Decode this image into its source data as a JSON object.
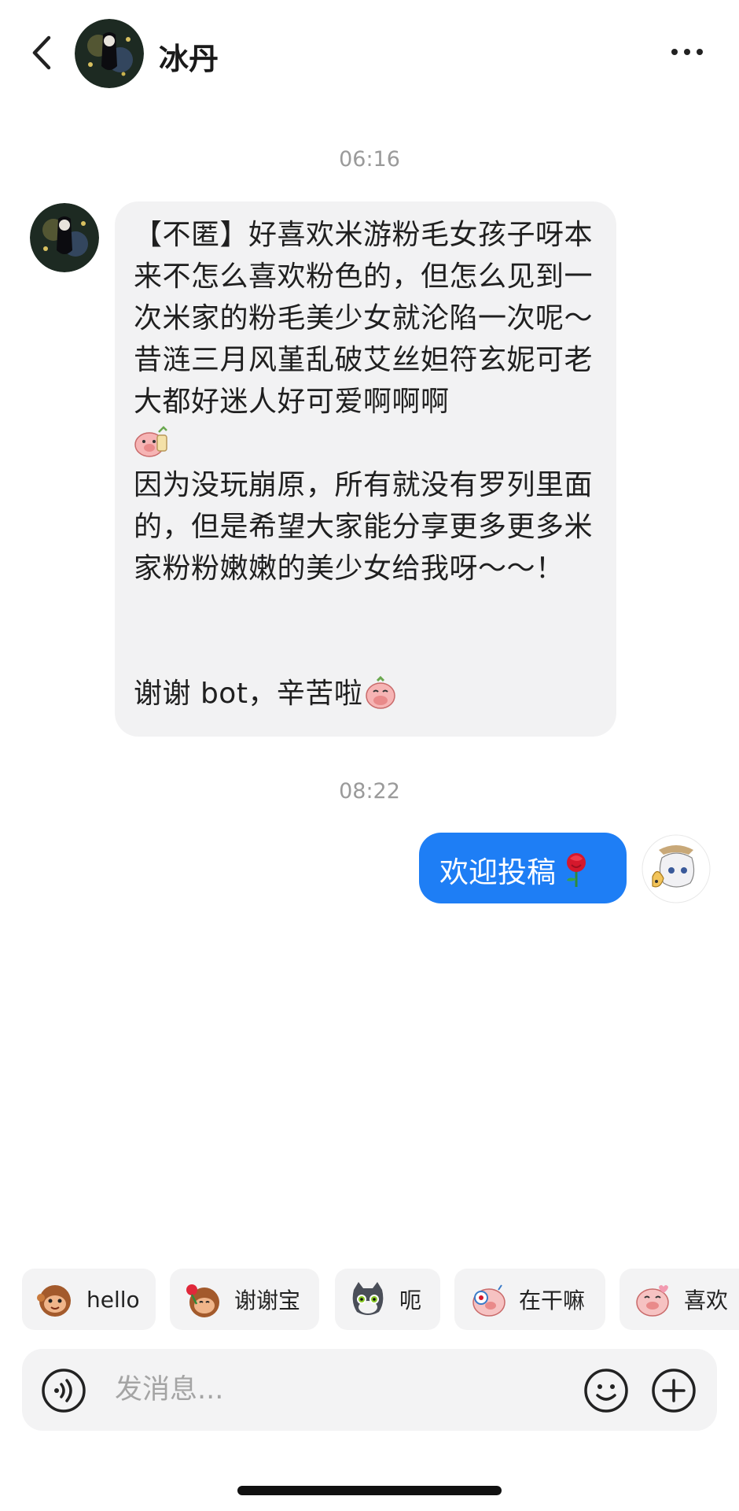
{
  "header": {
    "contact_name": "冰丹",
    "back_icon": "chevron-left-icon",
    "more_icon": "more-horizontal-icon"
  },
  "messages": [
    {
      "time": "06:16",
      "direction": "incoming",
      "lines": [
        "【不匿】好喜欢米游粉毛女孩子呀本来不怎么喜欢粉色的，但怎么见到一次米家的粉毛美少女就沦陷一次呢～昔涟三月风堇乱破艾丝妲符玄妮可老大都好迷人好可爱啊啊啊",
        "因为没玩崩原，所有就没有罗列里面的，但是希望大家能分享更多更多米家粉粉嫩嫩的美少女给我呀～～！",
        "",
        "谢谢 bot，辛苦啦"
      ]
    },
    {
      "time": "08:22",
      "direction": "outgoing",
      "text": "欢迎投稿"
    }
  ],
  "quick_replies": [
    {
      "label": "hello"
    },
    {
      "label": "谢谢宝"
    },
    {
      "label": "呃"
    },
    {
      "label": "在干嘛"
    },
    {
      "label": "喜欢"
    }
  ],
  "composer": {
    "placeholder": "发消息..."
  },
  "colors": {
    "outgoing_bubble": "#1e7ef5",
    "incoming_bubble": "#f2f2f3",
    "timestamp": "#9a9a9a"
  }
}
